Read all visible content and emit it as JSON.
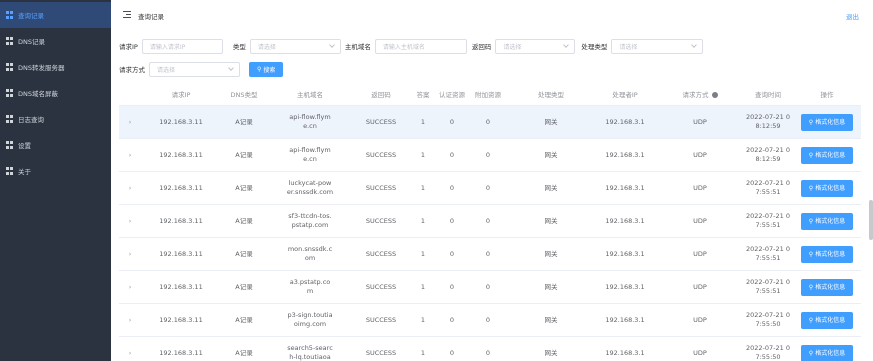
{
  "sidebar": {
    "items": [
      {
        "label": "查询记录"
      },
      {
        "label": "DNS记录"
      },
      {
        "label": "DNS转发服务器"
      },
      {
        "label": "DNS域名屏蔽"
      },
      {
        "label": "日志查询"
      },
      {
        "label": "设置"
      },
      {
        "label": "关于"
      }
    ]
  },
  "header": {
    "title": "查询记录",
    "logout": "退出"
  },
  "filters": {
    "client_ip_label": "请求IP",
    "client_ip_placeholder": "请输入请求IP",
    "type_label": "类型",
    "type_placeholder": "请选择",
    "host_label": "主机域名",
    "host_placeholder": "请输入主机域名",
    "rcode_label": "返回码",
    "rcode_placeholder": "请选择",
    "proc_label": "处理类型",
    "proc_placeholder": "请选择",
    "method_label": "请求方式",
    "method_placeholder": "请选择",
    "search_label": "搜索"
  },
  "table": {
    "headers": {
      "ip": "请求IP",
      "type": "DNS类型",
      "host": "主机域名",
      "rcode": "返回码",
      "answer": "答案",
      "auth": "认证资源",
      "additional": "附加资源",
      "proc": "处理类型",
      "proc_ip": "处理者IP",
      "method": "请求方式",
      "time": "查询时间",
      "op": "操作"
    },
    "button_label": "格式化信息",
    "rows": [
      {
        "ip": "192.168.3.11",
        "type": "A记录",
        "host1": "api-flow.flym",
        "host2": "e.cn",
        "rcode": "SUCCESS",
        "ans": "1",
        "auth": "0",
        "add": "0",
        "proc": "网关",
        "pip": "192.168.3.1",
        "method": "UDP",
        "t1": "2022-07-21 0",
        "t2": "8:12:59"
      },
      {
        "ip": "192.168.3.11",
        "type": "A记录",
        "host1": "api-flow.flym",
        "host2": "e.cn",
        "rcode": "SUCCESS",
        "ans": "1",
        "auth": "0",
        "add": "0",
        "proc": "网关",
        "pip": "192.168.3.1",
        "method": "UDP",
        "t1": "2022-07-21 0",
        "t2": "8:12:59"
      },
      {
        "ip": "192.168.3.11",
        "type": "A记录",
        "host1": "luckycat-pow",
        "host2": "er.snssdk.com",
        "rcode": "SUCCESS",
        "ans": "1",
        "auth": "0",
        "add": "0",
        "proc": "网关",
        "pip": "192.168.3.1",
        "method": "UDP",
        "t1": "2022-07-21 0",
        "t2": "7:55:51"
      },
      {
        "ip": "192.168.3.11",
        "type": "A记录",
        "host1": "sf3-ttcdn-tos.",
        "host2": "pstatp.com",
        "rcode": "SUCCESS",
        "ans": "1",
        "auth": "0",
        "add": "0",
        "proc": "网关",
        "pip": "192.168.3.1",
        "method": "UDP",
        "t1": "2022-07-21 0",
        "t2": "7:55:51"
      },
      {
        "ip": "192.168.3.11",
        "type": "A记录",
        "host1": "mon.snssdk.c",
        "host2": "om",
        "rcode": "SUCCESS",
        "ans": "1",
        "auth": "0",
        "add": "0",
        "proc": "网关",
        "pip": "192.168.3.1",
        "method": "UDP",
        "t1": "2022-07-21 0",
        "t2": "7:55:51"
      },
      {
        "ip": "192.168.3.11",
        "type": "A记录",
        "host1": "a3.pstatp.co",
        "host2": "m",
        "rcode": "SUCCESS",
        "ans": "1",
        "auth": "0",
        "add": "0",
        "proc": "网关",
        "pip": "192.168.3.1",
        "method": "UDP",
        "t1": "2022-07-21 0",
        "t2": "7:55:51"
      },
      {
        "ip": "192.168.3.11",
        "type": "A记录",
        "host1": "p3-sign.toutia",
        "host2": "oimg.com",
        "rcode": "SUCCESS",
        "ans": "1",
        "auth": "0",
        "add": "0",
        "proc": "网关",
        "pip": "192.168.3.1",
        "method": "UDP",
        "t1": "2022-07-21 0",
        "t2": "7:55:50"
      },
      {
        "ip": "192.168.3.11",
        "type": "A记录",
        "host1": "search5-searc",
        "host2": "h-lq.toutiaoa",
        "rcode": "SUCCESS",
        "ans": "1",
        "auth": "0",
        "add": "0",
        "proc": "网关",
        "pip": "192.168.3.1",
        "method": "UDP",
        "t1": "2022-07-21 0",
        "t2": "7:55:50"
      }
    ]
  }
}
